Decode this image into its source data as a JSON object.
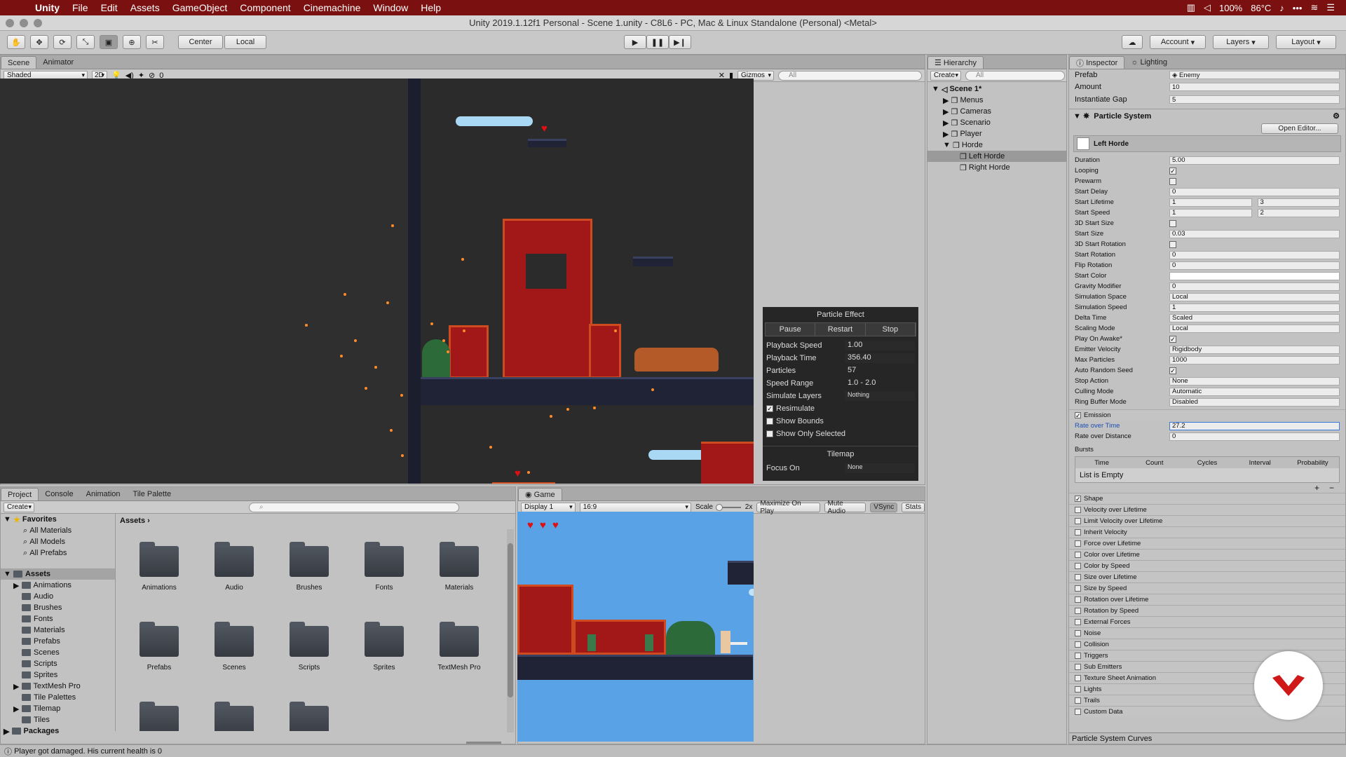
{
  "menubar": {
    "app": "Unity",
    "items": [
      "File",
      "Edit",
      "Assets",
      "GameObject",
      "Component",
      "Cinemachine",
      "Window",
      "Help"
    ],
    "battery": "100%",
    "temp": "86°C"
  },
  "window_title": "Unity 2019.1.12f1 Personal - Scene 1.unity - C8L6 - PC, Mac & Linux Standalone (Personal) <Metal>",
  "toolbar": {
    "pivot": "Center",
    "space": "Local",
    "account": "Account",
    "layers": "Layers",
    "layout": "Layout"
  },
  "scene": {
    "tabs": [
      "Scene",
      "Animator"
    ],
    "shading": "Shaded",
    "mode_2d": "2D",
    "hidden_count": "0",
    "gizmos": "Gizmos",
    "search_placeholder": "All"
  },
  "particle_effect": {
    "title": "Particle Effect",
    "buttons": [
      "Pause",
      "Restart",
      "Stop"
    ],
    "rows": [
      {
        "label": "Playback Speed",
        "value": "1.00"
      },
      {
        "label": "Playback Time",
        "value": "356.40"
      },
      {
        "label": "Particles",
        "value": "57"
      },
      {
        "label": "Speed Range",
        "value": "1.0 - 2.0"
      },
      {
        "label": "Simulate Layers",
        "value": "Nothing"
      }
    ],
    "checks": [
      {
        "label": "Resimulate",
        "checked": true
      },
      {
        "label": "Show Bounds",
        "checked": false
      },
      {
        "label": "Show Only Selected",
        "checked": false
      }
    ],
    "tilemap_title": "Tilemap",
    "focus_label": "Focus On",
    "focus_value": "None"
  },
  "hierarchy": {
    "tab": "Hierarchy",
    "create": "Create",
    "search_placeholder": "All",
    "scene": "Scene 1*",
    "items": [
      {
        "label": "Menus",
        "indent": 1,
        "expanded": false
      },
      {
        "label": "Cameras",
        "indent": 1,
        "expanded": false
      },
      {
        "label": "Scenario",
        "indent": 1,
        "expanded": false
      },
      {
        "label": "Player",
        "indent": 1,
        "expanded": false
      },
      {
        "label": "Horde",
        "indent": 1,
        "expanded": true
      },
      {
        "label": "Left Horde",
        "indent": 2,
        "selected": true
      },
      {
        "label": "Right Horde",
        "indent": 2
      }
    ]
  },
  "inspector": {
    "tabs": [
      "Inspector",
      "Lighting"
    ],
    "top_rows": [
      {
        "label": "Prefab",
        "value": "Enemy"
      },
      {
        "label": "Amount",
        "value": "10"
      },
      {
        "label": "Instantiate Gap",
        "value": "5"
      }
    ],
    "component": "Particle System",
    "open_editor": "Open Editor...",
    "system_name": "Left Horde",
    "rows": [
      {
        "label": "Duration",
        "value": "5.00"
      },
      {
        "label": "Looping",
        "check": true
      },
      {
        "label": "Prewarm",
        "check": false
      },
      {
        "label": "Start Delay",
        "value": "0"
      },
      {
        "label": "Start Lifetime",
        "value": "1",
        "value2": "3"
      },
      {
        "label": "Start Speed",
        "value": "1",
        "value2": "2"
      },
      {
        "label": "3D Start Size",
        "check": false
      },
      {
        "label": "Start Size",
        "value": "0.03"
      },
      {
        "label": "3D Start Rotation",
        "check": false
      },
      {
        "label": "Start Rotation",
        "value": "0"
      },
      {
        "label": "Flip Rotation",
        "value": "0"
      },
      {
        "label": "Start Color",
        "value": ""
      },
      {
        "label": "Gravity Modifier",
        "value": "0"
      },
      {
        "label": "Simulation Space",
        "value": "Local"
      },
      {
        "label": "Simulation Speed",
        "value": "1"
      },
      {
        "label": "Delta Time",
        "value": "Scaled"
      },
      {
        "label": "Scaling Mode",
        "value": "Local"
      },
      {
        "label": "Play On Awake*",
        "check": true
      },
      {
        "label": "Emitter Velocity",
        "value": "Rigidbody"
      },
      {
        "label": "Max Particles",
        "value": "1000"
      },
      {
        "label": "Auto Random Seed",
        "check": true
      },
      {
        "label": "Stop Action",
        "value": "None"
      },
      {
        "label": "Culling Mode",
        "value": "Automatic"
      },
      {
        "label": "Ring Buffer Mode",
        "value": "Disabled"
      }
    ],
    "emission": {
      "title": "Emission",
      "rows": [
        {
          "label": "Rate over Time",
          "value": "27.2"
        },
        {
          "label": "Rate over Distance",
          "value": "0"
        }
      ],
      "bursts": "Bursts",
      "burst_cols": [
        "Time",
        "Count",
        "Cycles",
        "Interval",
        "Probability"
      ],
      "empty": "List is Empty"
    },
    "modules": [
      {
        "label": "Shape",
        "checked": true
      },
      {
        "label": "Velocity over Lifetime"
      },
      {
        "label": "Limit Velocity over Lifetime"
      },
      {
        "label": "Inherit Velocity"
      },
      {
        "label": "Force over Lifetime"
      },
      {
        "label": "Color over Lifetime"
      },
      {
        "label": "Color by Speed"
      },
      {
        "label": "Size over Lifetime"
      },
      {
        "label": "Size by Speed"
      },
      {
        "label": "Rotation over Lifetime"
      },
      {
        "label": "Rotation by Speed"
      },
      {
        "label": "External Forces"
      },
      {
        "label": "Noise"
      },
      {
        "label": "Collision"
      },
      {
        "label": "Triggers"
      },
      {
        "label": "Sub Emitters"
      },
      {
        "label": "Texture Sheet Animation"
      },
      {
        "label": "Lights"
      },
      {
        "label": "Trails"
      },
      {
        "label": "Custom Data"
      }
    ],
    "curves": "Particle System Curves"
  },
  "project": {
    "tabs": [
      "Project",
      "Console",
      "Animation",
      "Tile Palette"
    ],
    "create": "Create",
    "favorites": "Favorites",
    "fav_items": [
      "All Materials",
      "All Models",
      "All Prefabs"
    ],
    "assets_root": "Assets",
    "tree": [
      {
        "label": "Animations",
        "arrow": true
      },
      {
        "label": "Audio"
      },
      {
        "label": "Brushes"
      },
      {
        "label": "Fonts"
      },
      {
        "label": "Materials"
      },
      {
        "label": "Prefabs"
      },
      {
        "label": "Scenes"
      },
      {
        "label": "Scripts"
      },
      {
        "label": "Sprites"
      },
      {
        "label": "TextMesh Pro",
        "arrow": true
      },
      {
        "label": "Tile Palettes"
      },
      {
        "label": "Tilemap",
        "arrow": true
      },
      {
        "label": "Tiles"
      }
    ],
    "packages": "Packages",
    "breadcrumb": "Assets",
    "folders": [
      "Animations",
      "Audio",
      "Brushes",
      "Fonts",
      "Materials",
      "Prefabs",
      "Scenes",
      "Scripts",
      "Sprites",
      "TextMesh Pro",
      "",
      "",
      ""
    ]
  },
  "game": {
    "tab": "Game",
    "display": "Display 1",
    "aspect": "16:9",
    "scale_label": "Scale",
    "scale_value": "2x",
    "buttons": [
      "Maximize On Play",
      "Mute Audio",
      "VSync",
      "Stats"
    ]
  },
  "status": "Player got damaged. His current health is 0"
}
